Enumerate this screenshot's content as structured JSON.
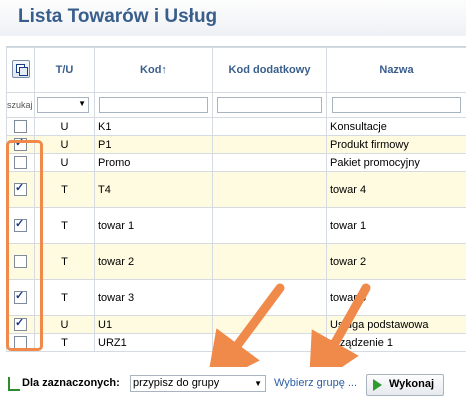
{
  "title": "Lista Towarów i Usług",
  "columns": {
    "tu": "T/U",
    "kod": "Kod↑",
    "kod_dod": "Kod dodatkowy",
    "nazwa": "Nazwa"
  },
  "search_label": "szukaj →",
  "rows": [
    {
      "checked": false,
      "tu": "U",
      "kod": "K1",
      "nazwa": "Konsultacje"
    },
    {
      "checked": true,
      "tu": "U",
      "kod": "P1",
      "nazwa": "Produkt firmowy"
    },
    {
      "checked": false,
      "tu": "U",
      "kod": "Promo",
      "nazwa": "Pakiet promocyjny"
    },
    {
      "checked": true,
      "tu": "T",
      "kod": "T4",
      "nazwa": "towar 4"
    },
    {
      "checked": true,
      "tu": "T",
      "kod": "towar 1",
      "nazwa": "towar 1"
    },
    {
      "checked": false,
      "tu": "T",
      "kod": "towar 2",
      "nazwa": "towar 2"
    },
    {
      "checked": true,
      "tu": "T",
      "kod": "towar 3",
      "nazwa": "towar 3"
    },
    {
      "checked": true,
      "tu": "U",
      "kod": "U1",
      "nazwa": "Usługa podstawowa"
    },
    {
      "checked": false,
      "tu": "T",
      "kod": "URZ1",
      "nazwa": "urządzenie 1"
    }
  ],
  "bottom": {
    "label": "Dla zaznaczonych:",
    "action": "przypisz do grupy",
    "pick_group": "Wybierz grupę ...",
    "execute": "Wykonaj"
  },
  "colors": {
    "highlight": "#f08a4b",
    "title": "#3a5e8c",
    "row_even": "#fffbe0"
  }
}
